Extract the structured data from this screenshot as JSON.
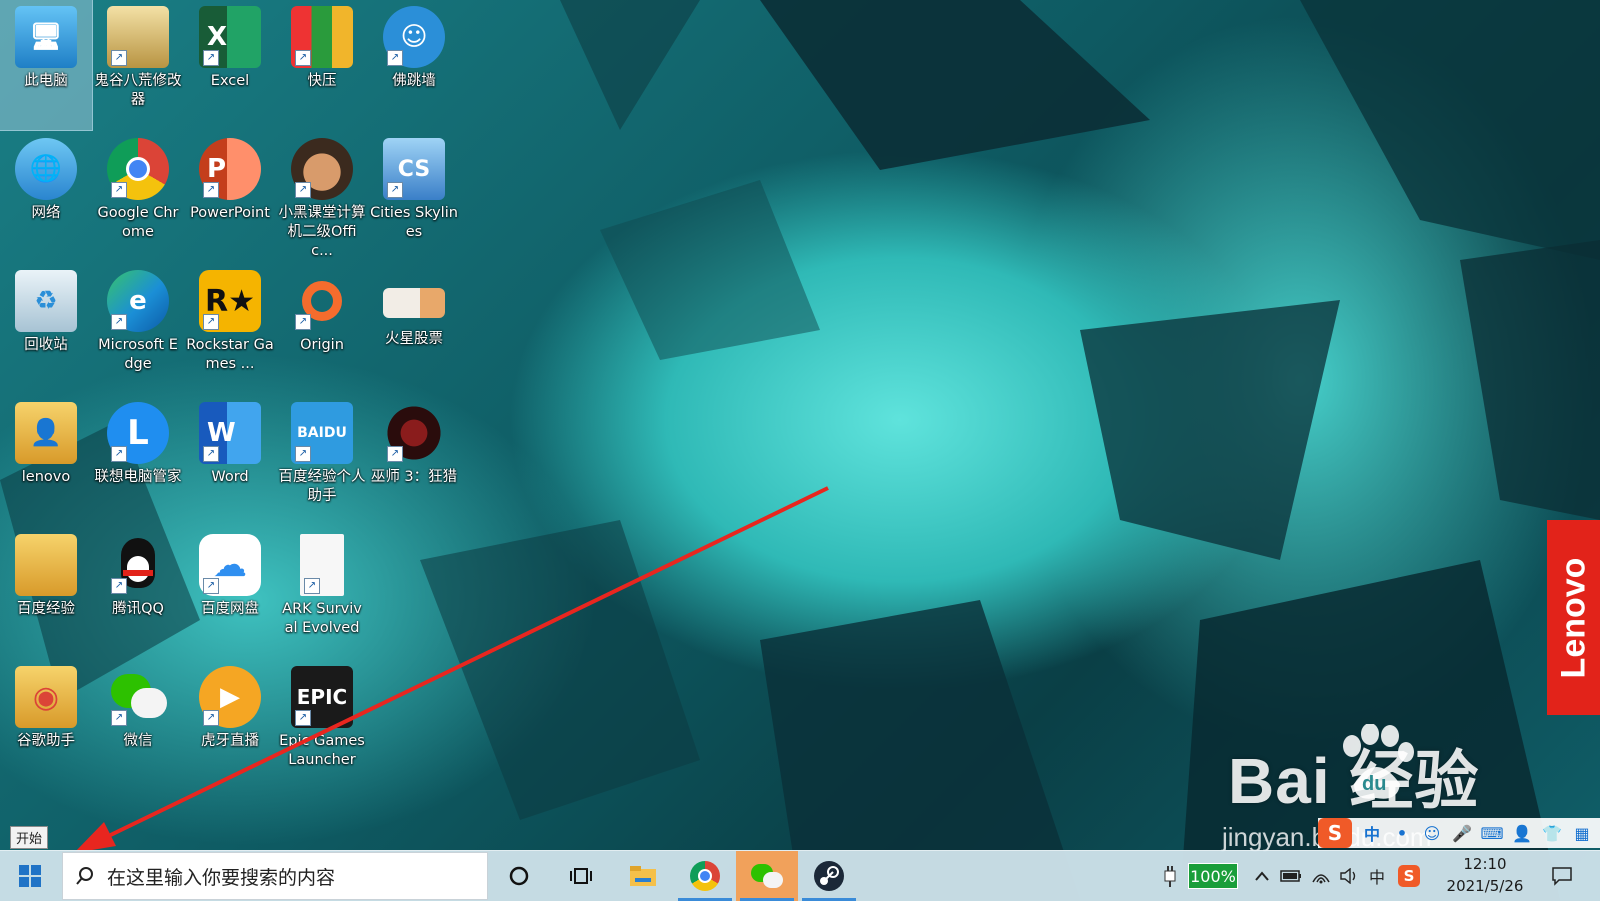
{
  "desktop": {
    "icons": [
      {
        "label": "此电脑",
        "icon": "this-pc-icon",
        "color": "#3a9ee0"
      },
      {
        "label": "鬼谷八荒修改器",
        "icon": "modifier-icon",
        "color": "#c9a84a"
      },
      {
        "label": "Excel",
        "icon": "excel-icon",
        "color": "#1d7a45"
      },
      {
        "label": "快压",
        "icon": "kuaiya-icon",
        "color": "#d6322f"
      },
      {
        "label": "佛跳墙",
        "icon": "fotiaoqiang-icon",
        "color": "#2b8fd8"
      },
      {
        "label": "网络",
        "icon": "network-icon",
        "color": "#3a9ee0"
      },
      {
        "label": "Google Chrome",
        "icon": "chrome-icon",
        "color": "#db4437"
      },
      {
        "label": "PowerPoint",
        "icon": "powerpoint-icon",
        "color": "#d04a2a"
      },
      {
        "label": "小黑课堂计算机二级Offic...",
        "icon": "xiaohei-icon",
        "color": "#5a3a24"
      },
      {
        "label": "Cities Skylines",
        "icon": "cities-skylines-icon",
        "color": "#3a7fc8"
      },
      {
        "label": "回收站",
        "icon": "recycle-bin-icon",
        "color": "#b9d2e2"
      },
      {
        "label": "Microsoft Edge",
        "icon": "edge-icon",
        "color": "#1b8fd6"
      },
      {
        "label": "Rockstar Games ...",
        "icon": "rockstar-icon",
        "color": "#f5b400"
      },
      {
        "label": "Origin",
        "icon": "origin-icon",
        "color": "#f56c2d"
      },
      {
        "label": "火星股票",
        "icon": "huoxing-stock-icon",
        "color": "#e8e1d6"
      },
      {
        "label": "lenovo",
        "icon": "folder-user-icon",
        "color": "#e9b53f"
      },
      {
        "label": "联想电脑管家",
        "icon": "lenovo-manager-icon",
        "color": "#1f8ef0"
      },
      {
        "label": "Word",
        "icon": "word-icon",
        "color": "#2b5cbb"
      },
      {
        "label": "百度经验个人助手",
        "icon": "baidu-jingyan-helper-icon",
        "color": "#2f9be0"
      },
      {
        "label": "巫师 3：狂猎",
        "icon": "witcher-icon",
        "color": "#3a1010"
      },
      {
        "label": "百度经验",
        "icon": "folder-icon",
        "color": "#e9b53f"
      },
      {
        "label": "腾讯QQ",
        "icon": "qq-icon",
        "color": "#111111"
      },
      {
        "label": "百度网盘",
        "icon": "baidu-netdisk-icon",
        "color": "#ffffff"
      },
      {
        "label": "ARK Survival Evolved",
        "icon": "file-icon",
        "color": "#f4f4f4"
      },
      {
        "label": "谷歌助手",
        "icon": "google-helper-icon",
        "color": "#e9b53f"
      },
      {
        "label": "微信",
        "icon": "wechat-icon",
        "color": "#2dc100"
      },
      {
        "label": "虎牙直播",
        "icon": "huya-icon",
        "color": "#f5a623"
      },
      {
        "label": "Epic Games Launcher",
        "icon": "epic-games-icon",
        "color": "#1a1a1a"
      }
    ]
  },
  "start_tooltip": "开始",
  "watermark": {
    "logo": "Bai  经验",
    "du": "du",
    "url": "jingyan.baidu.com"
  },
  "lenovo_tag": "Lenovo",
  "ime_bar": {
    "items": [
      "中",
      "•",
      "☺",
      "🎤",
      "⌨",
      "👤",
      "👕",
      "▦"
    ]
  },
  "taskbar": {
    "search_placeholder": "在这里输入你要搜索的内容",
    "apps": [
      {
        "name": "cortana",
        "icon": "cortana-icon"
      },
      {
        "name": "task-view",
        "icon": "task-view-icon"
      },
      {
        "name": "file-explorer",
        "icon": "file-explorer-icon"
      },
      {
        "name": "chrome",
        "icon": "chrome-icon"
      },
      {
        "name": "wechat",
        "icon": "wechat-icon"
      },
      {
        "name": "steam",
        "icon": "steam-icon"
      }
    ],
    "tray": {
      "battery_percent": "100%",
      "ime_char": "中",
      "time": "12:10",
      "date": "2021/5/26"
    }
  }
}
